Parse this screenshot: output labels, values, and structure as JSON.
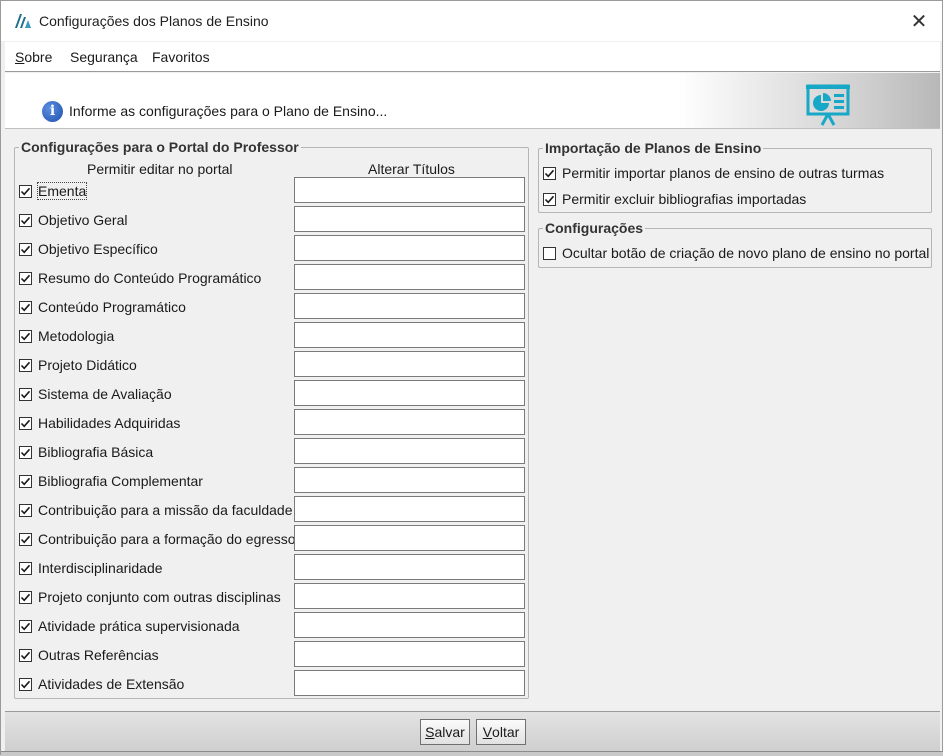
{
  "window": {
    "title": "Configurações dos Planos de Ensino",
    "close_glyph": "✕"
  },
  "menu": [
    {
      "label": "Sobre",
      "mnemonic": "S",
      "rest": "obre"
    },
    {
      "label": "Segurança",
      "mnemonic": "",
      "rest": "Segurança"
    },
    {
      "label": "Favoritos",
      "mnemonic": "",
      "rest": "Favoritos"
    }
  ],
  "banner": {
    "text": "Informe as configurações para o Plano de Ensino...",
    "info_icon": "info-icon",
    "info_glyph": "i",
    "right_icon": "presentation-board-icon",
    "accent": "#17a7c7"
  },
  "portal": {
    "legend": "Configurações para o Portal do Professor",
    "col_edit": "Permitir editar no portal",
    "col_titles": "Alterar Títulos",
    "items": [
      {
        "label": "Ementa",
        "checked": true,
        "title_value": ""
      },
      {
        "label": "Objetivo Geral",
        "checked": true,
        "title_value": ""
      },
      {
        "label": "Objetivo Específico",
        "checked": true,
        "title_value": ""
      },
      {
        "label": "Resumo do Conteúdo Programático",
        "checked": true,
        "title_value": ""
      },
      {
        "label": "Conteúdo Programático",
        "checked": true,
        "title_value": ""
      },
      {
        "label": "Metodologia",
        "checked": true,
        "title_value": ""
      },
      {
        "label": "Projeto Didático",
        "checked": true,
        "title_value": ""
      },
      {
        "label": "Sistema de Avaliação",
        "checked": true,
        "title_value": ""
      },
      {
        "label": "Habilidades Adquiridas",
        "checked": true,
        "title_value": ""
      },
      {
        "label": "Bibliografia Básica",
        "checked": true,
        "title_value": ""
      },
      {
        "label": "Bibliografia Complementar",
        "checked": true,
        "title_value": ""
      },
      {
        "label": "Contribuição para a missão da faculdade",
        "checked": true,
        "title_value": ""
      },
      {
        "label": "Contribuição para a formação do egresso",
        "checked": true,
        "title_value": ""
      },
      {
        "label": "Interdisciplinaridade",
        "checked": true,
        "title_value": ""
      },
      {
        "label": "Projeto conjunto com outras disciplinas",
        "checked": true,
        "title_value": ""
      },
      {
        "label": "Atividade prática supervisionada",
        "checked": true,
        "title_value": ""
      },
      {
        "label": "Outras Referências",
        "checked": true,
        "title_value": ""
      },
      {
        "label": "Atividades de Extensão",
        "checked": true,
        "title_value": ""
      }
    ]
  },
  "import": {
    "legend": "Importação de Planos de Ensino",
    "items": [
      {
        "label": "Permitir importar planos de ensino de outras turmas",
        "checked": true
      },
      {
        "label": "Permitir excluir bibliografias importadas",
        "checked": true
      }
    ]
  },
  "settings": {
    "legend": "Configurações",
    "items": [
      {
        "label": "Ocultar botão de criação de novo plano de ensino no portal",
        "checked": false
      }
    ]
  },
  "buttons": {
    "save": {
      "label": "Salvar",
      "mnemonic": "S",
      "rest": "alvar"
    },
    "back": {
      "label": "Voltar",
      "mnemonic": "V",
      "rest": "oltar"
    }
  }
}
